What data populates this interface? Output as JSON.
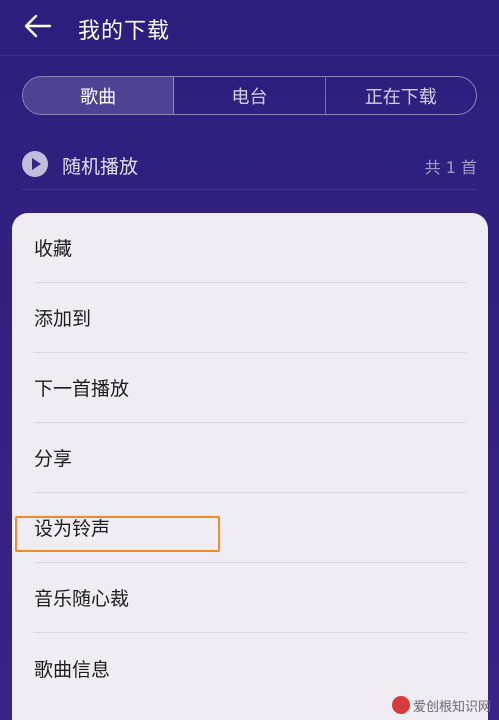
{
  "header": {
    "title": "我的下载",
    "back_icon": "arrow-left-icon"
  },
  "tabs": [
    {
      "label": "歌曲",
      "active": true
    },
    {
      "label": "电台",
      "active": false
    },
    {
      "label": "正在下载",
      "active": false
    }
  ],
  "shuffle": {
    "label": "随机播放",
    "count": "共 1 首",
    "icon": "play-circle-icon"
  },
  "menu": {
    "items": [
      {
        "label": "收藏"
      },
      {
        "label": "添加到"
      },
      {
        "label": "下一首播放"
      },
      {
        "label": "分享"
      },
      {
        "label": "设为铃声",
        "highlighted": true
      },
      {
        "label": "音乐随心裁"
      },
      {
        "label": "歌曲信息"
      }
    ]
  },
  "watermark": {
    "text": "爱创根知识网"
  },
  "colors": {
    "background": "#2b1d7a",
    "sheet": "#efecf4",
    "highlight": "#f08a2a"
  }
}
